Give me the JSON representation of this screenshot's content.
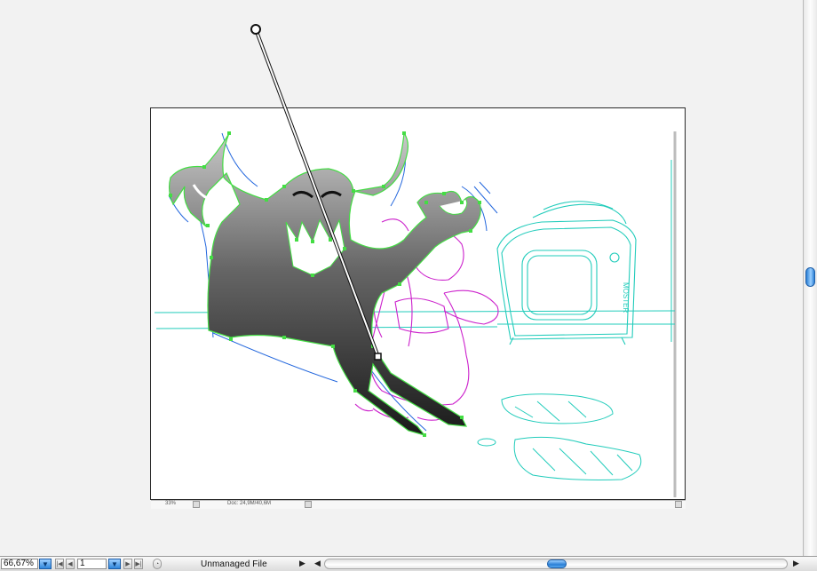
{
  "canvas": {
    "inner_zoom": "33%",
    "doc_info": "Doc: 24,9M/40,6M"
  },
  "statusbar": {
    "zoom_value": "66,67%",
    "page_value": "1",
    "file_status": "Unmanaged File"
  },
  "icons": {
    "zoom_dropdown": "chevron-down-icon",
    "first_page": "first-page-icon",
    "prev_page": "previous-page-icon",
    "next_page": "next-page-icon",
    "last_page": "last-page-icon",
    "status_menu": "triangle-right-icon",
    "scroll_left": "triangle-left-icon",
    "scroll_right": "triangle-right-icon"
  },
  "colors": {
    "path_outline": "#44dd44",
    "sketch_blue": "#2266dd",
    "sketch_magenta": "#cc22cc",
    "sketch_cyan": "#22ccbb",
    "thumb_blue": "#2a7fd6"
  }
}
